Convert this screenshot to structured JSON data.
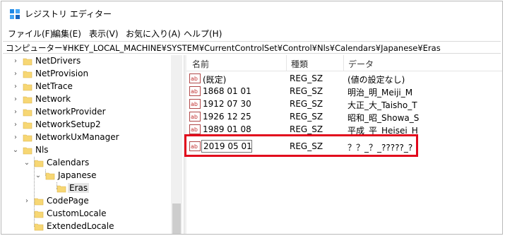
{
  "window": {
    "title": "レジストリ エディター"
  },
  "menu": [
    {
      "label": "ファイル(F)"
    },
    {
      "label": "編集(E)"
    },
    {
      "label": "表示(V)"
    },
    {
      "label": "お気に入り(A)"
    },
    {
      "label": "ヘルプ(H)"
    }
  ],
  "address": "コンピューター¥HKEY_LOCAL_MACHINE¥SYSTEM¥CurrentControlSet¥Control¥Nls¥Calendars¥Japanese¥Eras",
  "tree": [
    {
      "label": "NetDrivers",
      "expander": "›"
    },
    {
      "label": "NetProvision",
      "expander": "›"
    },
    {
      "label": "NetTrace",
      "expander": "›"
    },
    {
      "label": "Network",
      "expander": "›"
    },
    {
      "label": "NetworkProvider",
      "expander": "›"
    },
    {
      "label": "NetworkSetup2",
      "expander": "›"
    },
    {
      "label": "NetworkUxManager",
      "expander": "›"
    },
    {
      "label": "Nls",
      "expander": "⌄"
    },
    {
      "label": "Calendars",
      "expander": "⌄"
    },
    {
      "label": "Japanese",
      "expander": "⌄"
    },
    {
      "label": "Eras",
      "expander": ""
    },
    {
      "label": "CodePage",
      "expander": "›"
    },
    {
      "label": "CustomLocale",
      "expander": ""
    },
    {
      "label": "ExtendedLocale",
      "expander": ""
    }
  ],
  "list": {
    "headers": {
      "name": "名前",
      "type": "種類",
      "data": "データ"
    },
    "rows": [
      {
        "name": "(既定)",
        "type": "REG_SZ",
        "data": "(値の設定なし)"
      },
      {
        "name": "1868 01 01",
        "type": "REG_SZ",
        "data": "明治_明_Meiji_M"
      },
      {
        "name": "1912 07 30",
        "type": "REG_SZ",
        "data": "大正_大_Taisho_T"
      },
      {
        "name": "1926 12 25",
        "type": "REG_SZ",
        "data": "昭和_昭_Showa_S"
      },
      {
        "name": "1989 01 08",
        "type": "REG_SZ",
        "data": "平成_平_Heisei_H"
      },
      {
        "name": "2019 05 01",
        "type": "REG_SZ",
        "data": "？？_？_?????_?"
      }
    ]
  },
  "colors": {
    "highlight": "#e2081c",
    "folder": "#f7d774"
  }
}
